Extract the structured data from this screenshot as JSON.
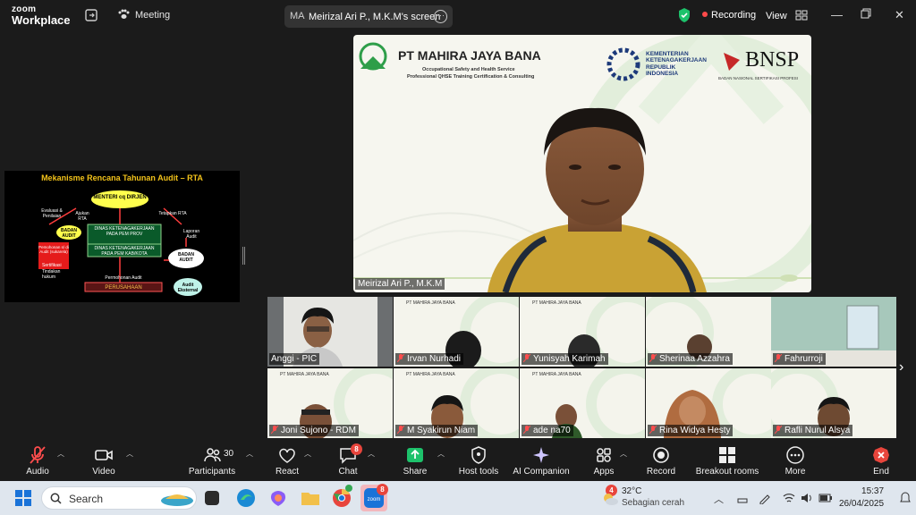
{
  "app": {
    "logo_line1": "zoom",
    "logo_line2": "Workplace"
  },
  "topbar": {
    "meeting_label": "Meeting",
    "screen_share_initials": "MA",
    "screen_share_label": "Meirizal Ari P., M.K.M's screen",
    "recording_label": "Recording",
    "view_label": "View"
  },
  "shared_slide": {
    "title": "Mekanisme Rencana Tahunan Audit – RTA",
    "boxes": {
      "menteri": "MENTERI cq DIRJEN",
      "evaluasi": "Evaluasi & Penilaian",
      "ajukan": "Ajukan RTA",
      "tetapkan": "Tetapkan RTA",
      "badan_audit": "BADAN AUDIT",
      "dinas_prov": "DINAS KETENAGAKERJAAN PADA PEM PROV",
      "dinas_kab": "DINAS KETENAGAKERJAAN PADA PEM KAB/KOTA",
      "laporan": "Laporan Audit",
      "badan_audit2": "BADAN AUDIT",
      "permohonan": "Permohonan Audit",
      "perusahaan": "PERUSAHAAN",
      "audit_eksternal": "Audit Eksternal",
      "pemohonan_sertifikasi": "Pemohonan s/ di Audit (sukarela)",
      "sertifikasi": "Sertifikasi",
      "tindakan": "Tindakan hukum"
    }
  },
  "main_video": {
    "company_name": "PT MAHIRA JAYA BANA",
    "company_sub1": "Occupational Safety and Health Service",
    "company_sub2": "Professional QHSE Training Certification & Consulting",
    "kementerian": [
      "KEMENTERIAN",
      "KETENAGAKERJAAN",
      "REPUBLIK",
      "INDONESIA"
    ],
    "bnsp": "BNSP",
    "bnsp_sub": "BADAN NASIONAL SERTIFIKASI PROFESI",
    "speaker_name": "Meirizal Ari P., M.K.M"
  },
  "participants": [
    {
      "name": "Anggi - PIC"
    },
    {
      "name": "Irvan Nurhadi"
    },
    {
      "name": "Yunisyah Karimah"
    },
    {
      "name": "Sherinaa Azzahra"
    },
    {
      "name": "Fahrurroji"
    },
    {
      "name": "Joni Sujono - RDM"
    },
    {
      "name": "M Syakirun Niam"
    },
    {
      "name": "ade na70"
    },
    {
      "name": "Rina Widya Hesty"
    },
    {
      "name": "Rafli Nurul Alsya"
    }
  ],
  "toolbar": {
    "audio": "Audio",
    "video": "Video",
    "participants": "Participants",
    "participants_count": "30",
    "react": "React",
    "chat": "Chat",
    "chat_badge": "8",
    "share": "Share",
    "host_tools": "Host tools",
    "ai_companion": "AI Companion",
    "apps": "Apps",
    "record": "Record",
    "breakout": "Breakout rooms",
    "more": "More",
    "end": "End"
  },
  "taskbar": {
    "search_placeholder": "Search",
    "zoom_badge": "8",
    "weather_badge": "4",
    "temperature": "32°C",
    "weather_desc": "Sebagian cerah",
    "time": "15:37",
    "date": "26/04/2025"
  },
  "colors": {
    "accent_green": "#1dc26b",
    "end_red": "#e8453c",
    "recording_red": "#ff4a4a"
  }
}
